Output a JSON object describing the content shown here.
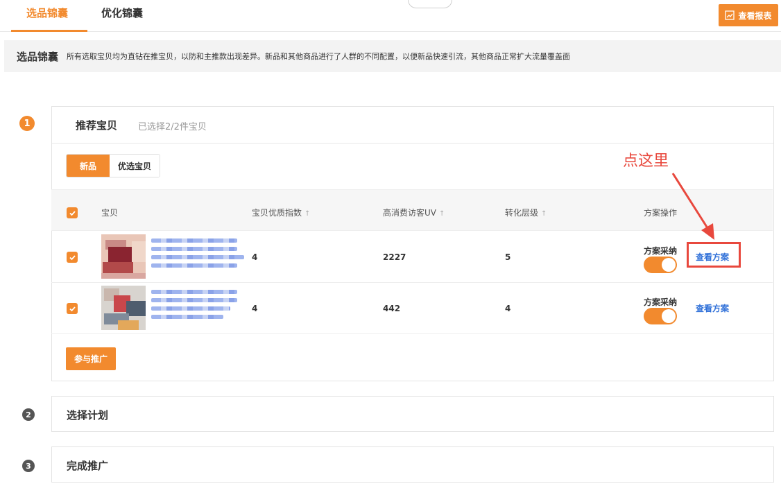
{
  "tabs": [
    {
      "label": "选品锦囊",
      "active": true
    },
    {
      "label": "优化锦囊",
      "active": false
    }
  ],
  "report_button": {
    "label": "查看报表",
    "icon": "chart-icon"
  },
  "notice": {
    "title": "选品锦囊",
    "text": "所有选取宝贝均为直钻在推宝贝，以防和主推款出现差异。新品和其他商品进行了人群的不同配置，以便新品快速引流，其他商品正常扩大流量覆盖面"
  },
  "steps": [
    {
      "number": "1",
      "title": "推荐宝贝",
      "subtitle": "已选择2/2件宝贝"
    },
    {
      "number": "2",
      "title": "选择计划"
    },
    {
      "number": "3",
      "title": "完成推广"
    }
  ],
  "segments": {
    "selected": "新品",
    "other": "优选宝贝"
  },
  "table": {
    "headers": {
      "item": "宝贝",
      "quality_index": "宝贝优质指数",
      "high_spend_uv": "高消费访客UV",
      "conversion_level": "转化层级",
      "plan_action": "方案操作"
    },
    "rows": [
      {
        "quality_index": "4",
        "high_spend_uv": "2227",
        "conversion_level": "5",
        "adopt_label": "方案采纳",
        "view_label": "查看方案",
        "checked": true,
        "adopt_on": true
      },
      {
        "quality_index": "4",
        "high_spend_uv": "442",
        "conversion_level": "4",
        "adopt_label": "方案采纳",
        "view_label": "查看方案",
        "checked": true,
        "adopt_on": true
      }
    ]
  },
  "join_button": {
    "label": "参与推广"
  },
  "annotation": {
    "text": "点这里",
    "color": "#e8483d"
  },
  "colors": {
    "accent": "#f28a2e",
    "link": "#2e6fd8",
    "annotation": "#e8483d"
  }
}
